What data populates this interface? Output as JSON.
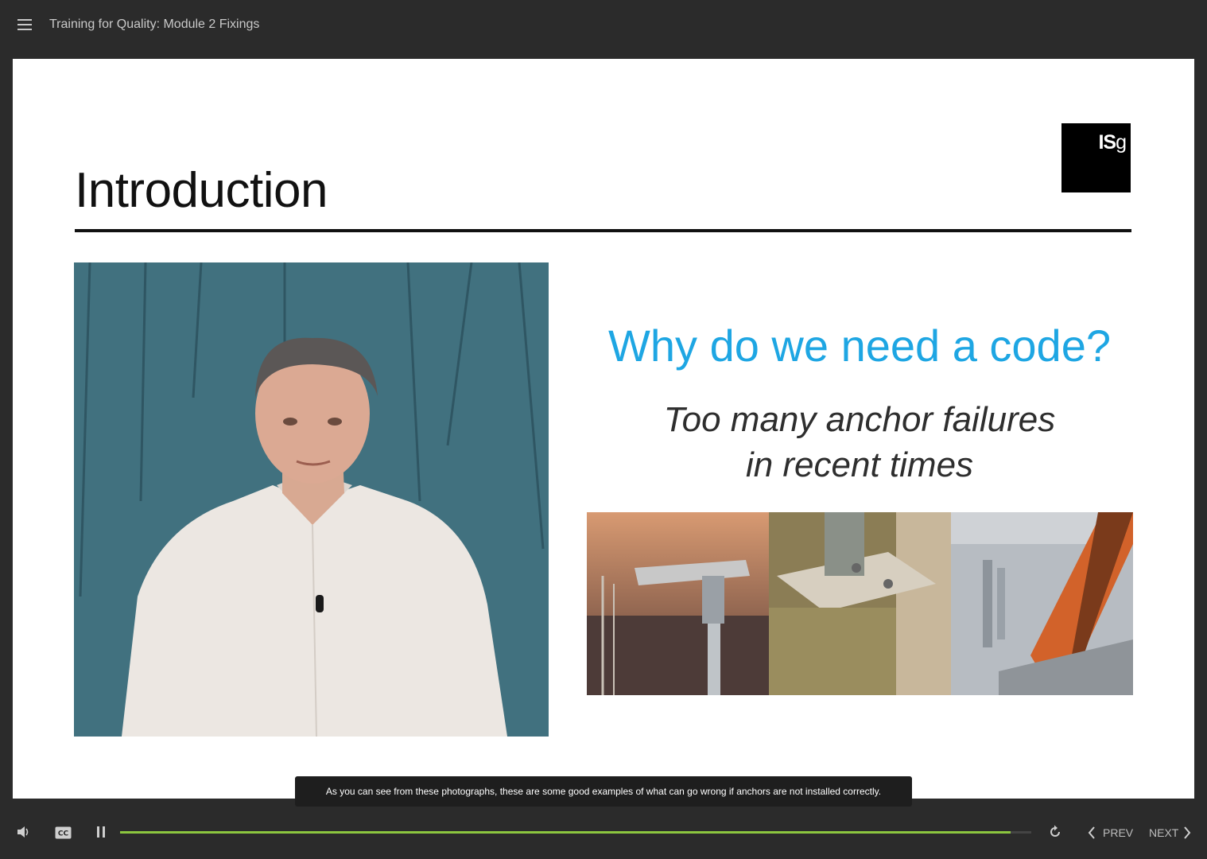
{
  "app": {
    "course_title": "Training for Quality: Module 2 Fixings"
  },
  "slide": {
    "title": "Introduction",
    "logo": {
      "text_bold": "IS",
      "text_light": "g"
    },
    "headline": "Why do we need a code?",
    "subtext_line1": "Too many anchor failures",
    "subtext_line2": "in recent times",
    "colors": {
      "headline": "#1ea6e3",
      "title": "#111111"
    }
  },
  "caption": {
    "text": "As you can see from these photographs, these are some good examples of what can go wrong if anchors are not installed correctly."
  },
  "player": {
    "progress": 0.977,
    "prev_label": "PREV",
    "next_label": "NEXT",
    "icons": [
      "volume-icon",
      "closed-captions-icon",
      "pause-icon",
      "replay-icon",
      "chevron-left-icon",
      "chevron-right-icon"
    ],
    "colors": {
      "progress": "#8cc63f",
      "background": "#2b2b2b"
    }
  }
}
